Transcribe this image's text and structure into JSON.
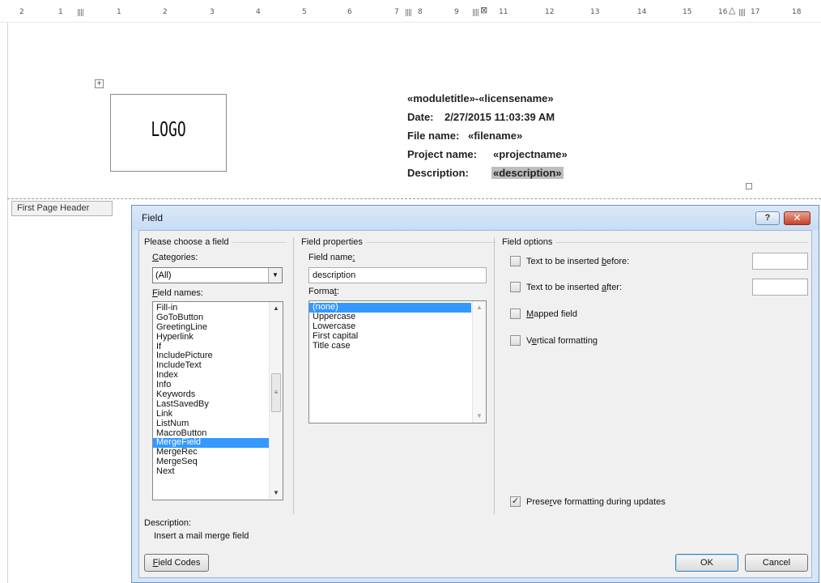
{
  "ruler": {
    "marks": [
      "2",
      "1",
      "1",
      "2",
      "3",
      "4",
      "5",
      "6",
      "7",
      "8",
      "9",
      "11",
      "12",
      "13",
      "14",
      "15",
      "16",
      "17",
      "18"
    ]
  },
  "document": {
    "logo": "LOGO",
    "header": {
      "line1": "«moduletitle»-«licensename»",
      "date_label": "Date:",
      "date_value": "2/27/2015 11:03:39 AM",
      "file_label": "File name:",
      "file_value": "«filename»",
      "project_label": "Project name:",
      "project_value": "«projectname»",
      "desc_label": "Description:",
      "desc_value": "«description»"
    },
    "header_tag": "First Page Header"
  },
  "dialog": {
    "title": "Field",
    "help_button": "?",
    "close_button": "✕",
    "choose_group": {
      "title": "Please choose a field",
      "categories_label": "Categories:",
      "categories_value": "(All)",
      "field_names_label": "Field names:",
      "field_names": [
        "Fill-in",
        "GoToButton",
        "GreetingLine",
        "Hyperlink",
        "If",
        "IncludePicture",
        "IncludeText",
        "Index",
        "Info",
        "Keywords",
        "LastSavedBy",
        "Link",
        "ListNum",
        "MacroButton",
        "MergeField",
        "MergeRec",
        "MergeSeq",
        "Next"
      ],
      "selected_field": "MergeField"
    },
    "properties_group": {
      "title": "Field properties",
      "field_name_label": "Field name:",
      "field_name_value": "description",
      "format_label": "Format:",
      "formats": [
        "(none)",
        "Uppercase",
        "Lowercase",
        "First capital",
        "Title case"
      ],
      "selected_format": "(none)"
    },
    "options_group": {
      "title": "Field options",
      "opt_before": "Text to be inserted before:",
      "opt_after": "Text to be inserted after:",
      "opt_mapped": "Mapped field",
      "opt_vertical": "Vertical formatting",
      "opt_preserve": "Preserve formatting during updates",
      "preserve_checked": true
    },
    "description": {
      "label": "Description:",
      "text": "Insert a mail merge field"
    },
    "buttons": {
      "field_codes": "Field Codes",
      "ok": "OK",
      "cancel": "Cancel"
    }
  }
}
